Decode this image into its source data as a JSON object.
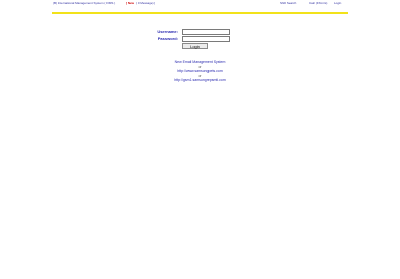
{
  "topbar": {
    "system_title": "(B) International Management System ( FIMS )",
    "new_label": "[ New",
    "message_link": "( 0 Message) ]",
    "nav": [
      "Shift Search",
      "Calc (FXmirs)",
      "Login"
    ]
  },
  "login": {
    "username_label": "Username:",
    "password_label": "Password:",
    "login_button": "Login"
  },
  "info": {
    "heading": "New Email Management System",
    "or1": "or",
    "url1": "http://www.samsungpets.com",
    "or2": "or",
    "url2": "http://gsm1.samsungrepsmtl.com"
  },
  "colors": {
    "accent_yellow": "#f2e21a",
    "link_blue": "#2a2ab0",
    "new_red": "#cc0000"
  }
}
